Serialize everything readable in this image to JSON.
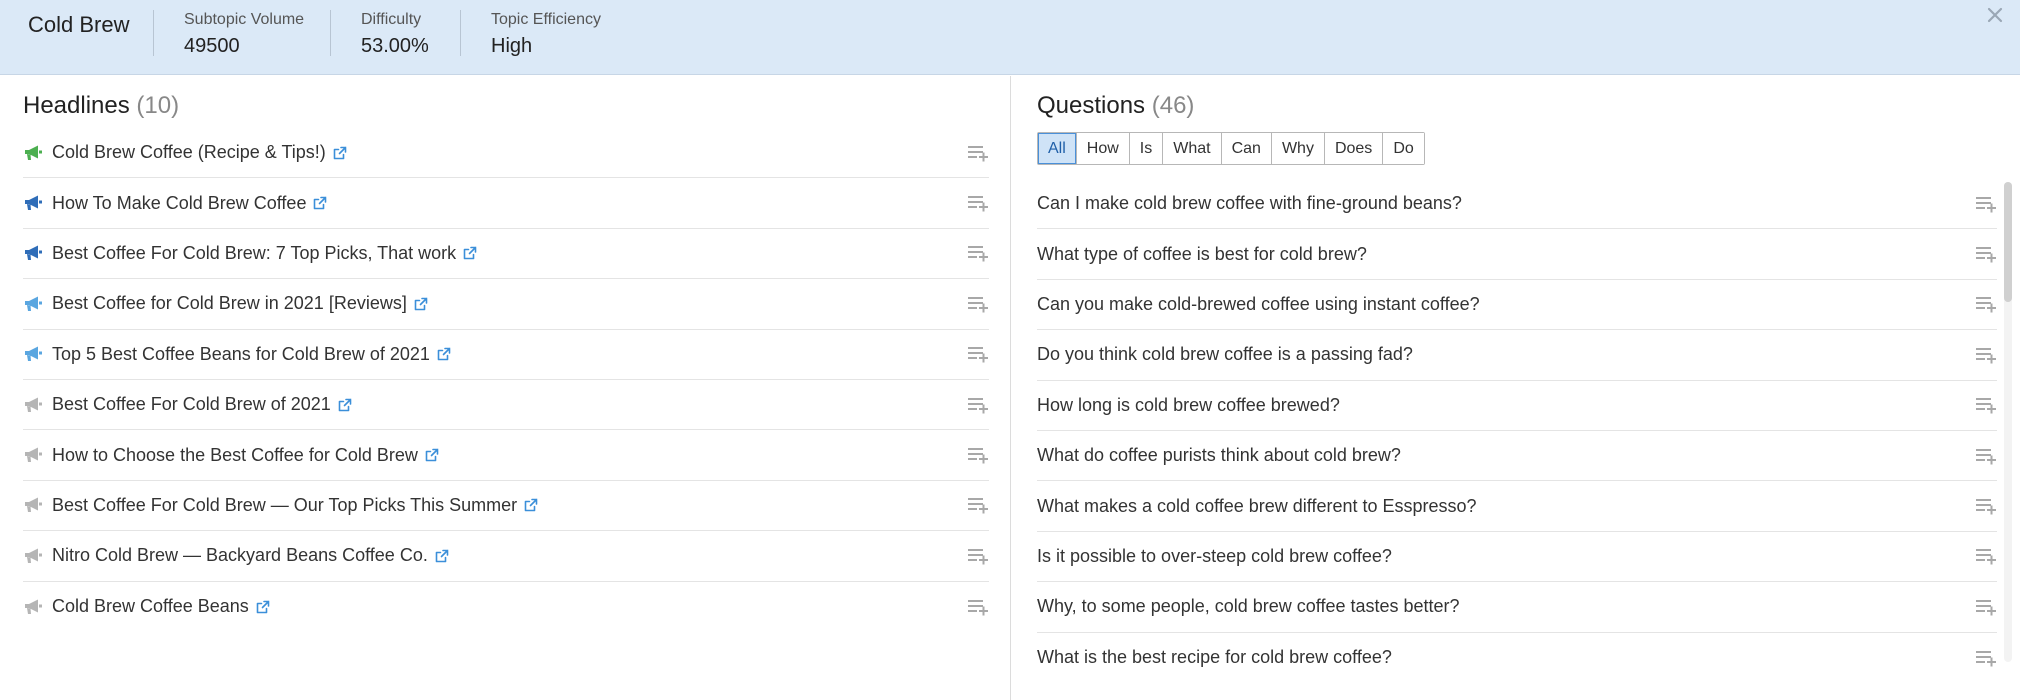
{
  "header": {
    "title": "Cold Brew",
    "metrics": [
      {
        "label": "Subtopic Volume",
        "value": "49500"
      },
      {
        "label": "Difficulty",
        "value": "53.00%"
      },
      {
        "label": "Topic Efficiency",
        "value": "High"
      }
    ]
  },
  "headlines": {
    "title": "Headlines",
    "count": "(10)",
    "items": [
      {
        "text": "Cold Brew Coffee (Recipe & Tips!)",
        "icon_color": "#4caf50"
      },
      {
        "text": "How To Make Cold Brew Coffee",
        "icon_color": "#2f6db8"
      },
      {
        "text": "Best Coffee For Cold Brew: 7 Top Picks, That work",
        "icon_color": "#2f6db8"
      },
      {
        "text": "Best Coffee for Cold Brew in 2021 [Reviews]",
        "icon_color": "#5aa6e0"
      },
      {
        "text": "Top 5 Best Coffee Beans for Cold Brew of 2021",
        "icon_color": "#5aa6e0"
      },
      {
        "text": "Best Coffee For Cold Brew of 2021",
        "icon_color": "#b5b5b5"
      },
      {
        "text": "How to Choose the Best Coffee for Cold Brew",
        "icon_color": "#b5b5b5"
      },
      {
        "text": "Best Coffee For Cold Brew — Our Top Picks This Summer",
        "icon_color": "#b5b5b5"
      },
      {
        "text": "Nitro Cold Brew — Backyard Beans Coffee Co.",
        "icon_color": "#b5b5b5"
      },
      {
        "text": "Cold Brew Coffee Beans",
        "icon_color": "#b5b5b5"
      }
    ]
  },
  "questions": {
    "title": "Questions",
    "count": "(46)",
    "filters": [
      "All",
      "How",
      "Is",
      "What",
      "Can",
      "Why",
      "Does",
      "Do"
    ],
    "active_filter": "All",
    "items": [
      "Can I make cold brew coffee with fine-ground beans?",
      "What type of coffee is best for cold brew?",
      "Can you make cold-brewed coffee using instant coffee?",
      "Do you think cold brew coffee is a passing fad?",
      "How long is cold brew coffee brewed?",
      "What do coffee purists think about cold brew?",
      "What makes a cold coffee brew different to Esspresso?",
      "Is it possible to over-steep cold brew coffee?",
      "Why, to some people, cold brew coffee tastes better?",
      "What is the best recipe for cold brew coffee?"
    ]
  },
  "icons": {
    "close": "close-icon",
    "external_link": "external-link-icon",
    "add_to_list": "add-to-list-icon",
    "headline_marker": "megaphone-icon"
  },
  "colors": {
    "header_bg": "#dbe9f7",
    "link_blue": "#3b8fd9",
    "active_filter_bg": "#cfe3f7"
  }
}
